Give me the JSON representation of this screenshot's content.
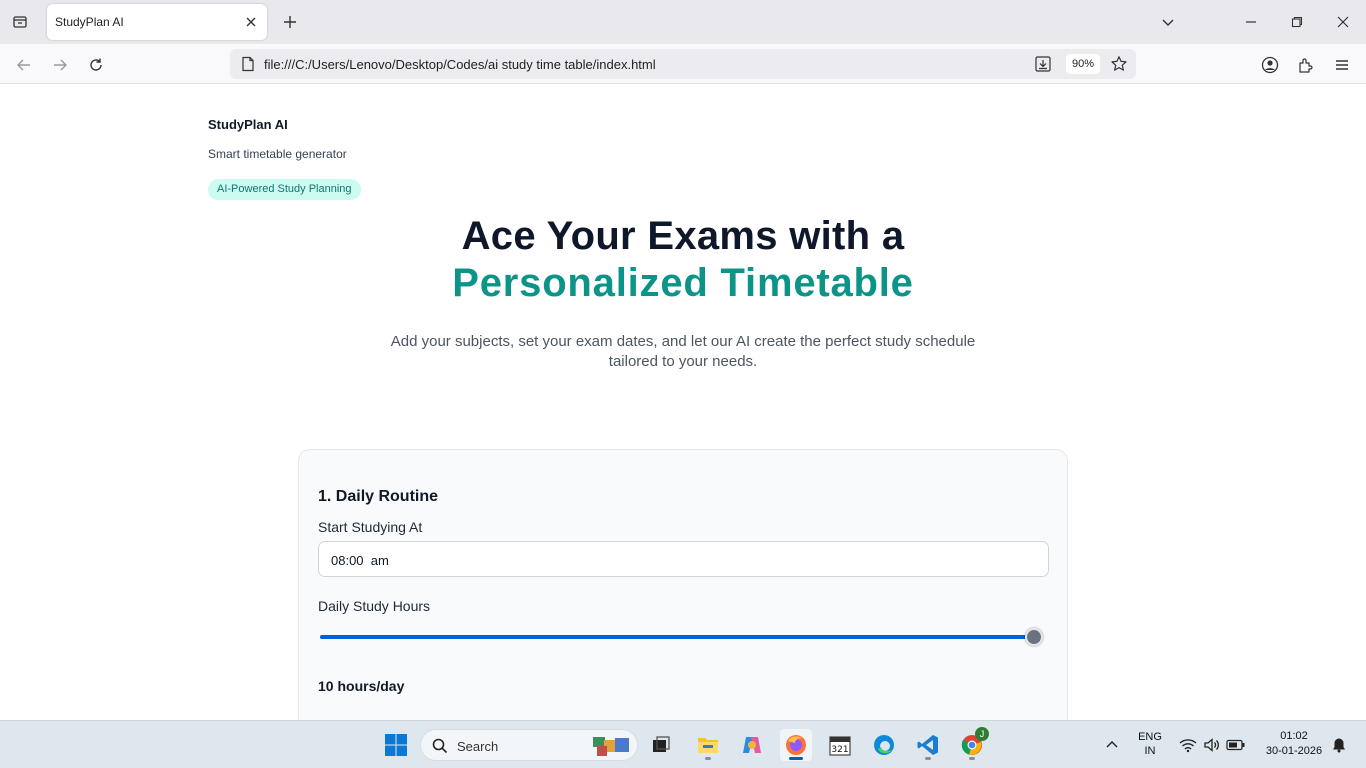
{
  "browser": {
    "tab_title": "StudyPlan AI",
    "url": "file:///C:/Users/Lenovo/Desktop/Codes/ai study time table/index.html",
    "zoom": "90%"
  },
  "page": {
    "brand_title": "StudyPlan AI",
    "brand_subtitle": "Smart timetable generator",
    "badge": "AI-Powered Study Planning",
    "hero_line1": "Ace Your Exams with a",
    "hero_line2": "Personalized Timetable",
    "hero_description": "Add your subjects, set your exam dates, and let our AI create the perfect study schedule tailored to your needs.",
    "colors": {
      "accent": "#0d9488",
      "badge_bg": "#ccfbf1",
      "slider": "#0060df"
    },
    "routine": {
      "title": "1. Daily Routine",
      "start_label": "Start Studying At",
      "start_time": "08:00  am",
      "hours_label": "Daily Study Hours",
      "hours_fraction": 1.0,
      "hours_value": "10 hours/day"
    }
  },
  "taskbar": {
    "search_label": "Search",
    "lang_top": "ENG",
    "lang_bottom": "IN",
    "time": "01:02",
    "date": "30-01-2026",
    "chrome_badge": "J"
  }
}
